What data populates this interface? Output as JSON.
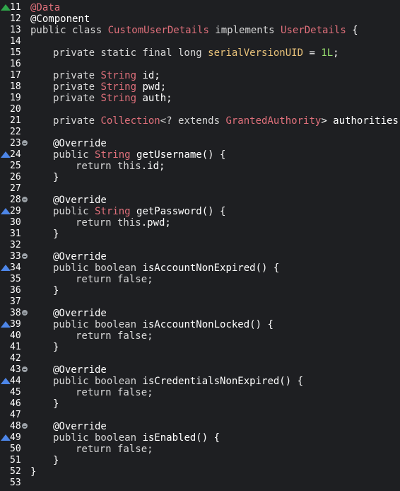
{
  "editor": {
    "colors": {
      "background": "#1e1f22",
      "keyword": "#d7d7d7",
      "type": "#e0707b",
      "field": "#e8c27a",
      "number": "#98e06f",
      "line_number": "#ffffff",
      "override_marker": "#4d86e8",
      "class_marker": "#2fa64a"
    },
    "lines": [
      {
        "num": "11",
        "marker": "green",
        "fold": false,
        "indent": 0,
        "tokens": [
          {
            "t": "@Data",
            "k": "ann-red"
          }
        ]
      },
      {
        "num": "12",
        "fold": false,
        "indent": 0,
        "tokens": [
          {
            "t": "@Component",
            "k": "ann"
          }
        ]
      },
      {
        "num": "13",
        "fold": false,
        "indent": 0,
        "tokens": [
          {
            "t": "public class ",
            "k": "kw"
          },
          {
            "t": "CustomUserDetails",
            "k": "type"
          },
          {
            "t": " implements ",
            "k": "kw"
          },
          {
            "t": "UserDetails",
            "k": "type"
          },
          {
            "t": " {",
            "k": "plain"
          }
        ]
      },
      {
        "num": "14",
        "fold": false,
        "indent": 0,
        "tokens": []
      },
      {
        "num": "15",
        "fold": false,
        "indent": 1,
        "tokens": [
          {
            "t": "private static final long ",
            "k": "kw"
          },
          {
            "t": "serialVersionUID",
            "k": "field"
          },
          {
            "t": " = ",
            "k": "plain"
          },
          {
            "t": "1L",
            "k": "num"
          },
          {
            "t": ";",
            "k": "plain"
          }
        ]
      },
      {
        "num": "16",
        "fold": false,
        "indent": 0,
        "tokens": []
      },
      {
        "num": "17",
        "fold": false,
        "indent": 1,
        "tokens": [
          {
            "t": "private ",
            "k": "kw"
          },
          {
            "t": "String",
            "k": "type"
          },
          {
            "t": " id;",
            "k": "plain"
          }
        ]
      },
      {
        "num": "18",
        "fold": false,
        "indent": 1,
        "tokens": [
          {
            "t": "private ",
            "k": "kw"
          },
          {
            "t": "String",
            "k": "type"
          },
          {
            "t": " pwd;",
            "k": "plain"
          }
        ]
      },
      {
        "num": "19",
        "fold": false,
        "indent": 1,
        "tokens": [
          {
            "t": "private ",
            "k": "kw"
          },
          {
            "t": "String",
            "k": "type"
          },
          {
            "t": " auth;",
            "k": "plain"
          }
        ]
      },
      {
        "num": "20",
        "fold": false,
        "indent": 0,
        "tokens": []
      },
      {
        "num": "21",
        "fold": false,
        "indent": 1,
        "tokens": [
          {
            "t": "private ",
            "k": "kw"
          },
          {
            "t": "Collection",
            "k": "type"
          },
          {
            "t": "<? extends ",
            "k": "kw"
          },
          {
            "t": "GrantedAuthority",
            "k": "type"
          },
          {
            "t": "> authorities;",
            "k": "plain"
          }
        ]
      },
      {
        "num": "22",
        "fold": false,
        "indent": 0,
        "tokens": []
      },
      {
        "num": "23",
        "fold": true,
        "indent": 1,
        "tokens": [
          {
            "t": "@Override",
            "k": "ann"
          }
        ]
      },
      {
        "num": "24",
        "marker": "blue",
        "fold": false,
        "indent": 1,
        "tokens": [
          {
            "t": "public ",
            "k": "kw"
          },
          {
            "t": "String",
            "k": "type"
          },
          {
            "t": " getUsername() {",
            "k": "plain"
          }
        ]
      },
      {
        "num": "25",
        "fold": false,
        "indent": 2,
        "tokens": [
          {
            "t": "return this",
            "k": "kw"
          },
          {
            "t": ".id;",
            "k": "plain"
          }
        ]
      },
      {
        "num": "26",
        "fold": false,
        "indent": 1,
        "tokens": [
          {
            "t": "}",
            "k": "plain"
          }
        ]
      },
      {
        "num": "27",
        "fold": false,
        "indent": 0,
        "tokens": []
      },
      {
        "num": "28",
        "fold": true,
        "indent": 1,
        "tokens": [
          {
            "t": "@Override",
            "k": "ann"
          }
        ]
      },
      {
        "num": "29",
        "marker": "blue",
        "fold": false,
        "indent": 1,
        "tokens": [
          {
            "t": "public ",
            "k": "kw"
          },
          {
            "t": "String",
            "k": "type"
          },
          {
            "t": " getPassword() {",
            "k": "plain"
          }
        ]
      },
      {
        "num": "30",
        "fold": false,
        "indent": 2,
        "tokens": [
          {
            "t": "return this",
            "k": "kw"
          },
          {
            "t": ".pwd;",
            "k": "plain"
          }
        ]
      },
      {
        "num": "31",
        "fold": false,
        "indent": 1,
        "tokens": [
          {
            "t": "}",
            "k": "plain"
          }
        ]
      },
      {
        "num": "32",
        "fold": false,
        "indent": 0,
        "tokens": []
      },
      {
        "num": "33",
        "fold": true,
        "indent": 1,
        "tokens": [
          {
            "t": "@Override",
            "k": "ann"
          }
        ]
      },
      {
        "num": "34",
        "marker": "blue",
        "fold": false,
        "indent": 1,
        "tokens": [
          {
            "t": "public boolean ",
            "k": "kw"
          },
          {
            "t": "isAccountNonExpired() {",
            "k": "plain"
          }
        ]
      },
      {
        "num": "35",
        "fold": false,
        "indent": 2,
        "tokens": [
          {
            "t": "return false;",
            "k": "kw"
          }
        ]
      },
      {
        "num": "36",
        "fold": false,
        "indent": 1,
        "tokens": [
          {
            "t": "}",
            "k": "plain"
          }
        ]
      },
      {
        "num": "37",
        "fold": false,
        "indent": 0,
        "tokens": []
      },
      {
        "num": "38",
        "fold": true,
        "indent": 1,
        "tokens": [
          {
            "t": "@Override",
            "k": "ann"
          }
        ]
      },
      {
        "num": "39",
        "marker": "blue",
        "fold": false,
        "indent": 1,
        "tokens": [
          {
            "t": "public boolean ",
            "k": "kw"
          },
          {
            "t": "isAccountNonLocked() {",
            "k": "plain"
          }
        ]
      },
      {
        "num": "40",
        "fold": false,
        "indent": 2,
        "tokens": [
          {
            "t": "return false;",
            "k": "kw"
          }
        ]
      },
      {
        "num": "41",
        "fold": false,
        "indent": 1,
        "tokens": [
          {
            "t": "}",
            "k": "plain"
          }
        ]
      },
      {
        "num": "42",
        "fold": false,
        "indent": 0,
        "tokens": []
      },
      {
        "num": "43",
        "fold": true,
        "indent": 1,
        "tokens": [
          {
            "t": "@Override",
            "k": "ann"
          }
        ]
      },
      {
        "num": "44",
        "marker": "blue",
        "fold": false,
        "indent": 1,
        "tokens": [
          {
            "t": "public boolean ",
            "k": "kw"
          },
          {
            "t": "isCredentialsNonExpired() {",
            "k": "plain"
          }
        ]
      },
      {
        "num": "45",
        "fold": false,
        "indent": 2,
        "tokens": [
          {
            "t": "return false;",
            "k": "kw"
          }
        ]
      },
      {
        "num": "46",
        "fold": false,
        "indent": 1,
        "tokens": [
          {
            "t": "}",
            "k": "plain"
          }
        ]
      },
      {
        "num": "47",
        "fold": false,
        "indent": 0,
        "tokens": []
      },
      {
        "num": "48",
        "fold": true,
        "indent": 1,
        "tokens": [
          {
            "t": "@Override",
            "k": "ann"
          }
        ]
      },
      {
        "num": "49",
        "marker": "blue",
        "fold": false,
        "indent": 1,
        "tokens": [
          {
            "t": "public boolean ",
            "k": "kw"
          },
          {
            "t": "isEnabled() {",
            "k": "plain"
          }
        ]
      },
      {
        "num": "50",
        "fold": false,
        "indent": 2,
        "tokens": [
          {
            "t": "return false;",
            "k": "kw"
          }
        ]
      },
      {
        "num": "51",
        "fold": false,
        "indent": 1,
        "tokens": [
          {
            "t": "}",
            "k": "plain"
          }
        ]
      },
      {
        "num": "52",
        "fold": false,
        "indent": 0,
        "tokens": [
          {
            "t": "}",
            "k": "plain"
          }
        ]
      },
      {
        "num": "53",
        "fold": false,
        "indent": 0,
        "tokens": []
      }
    ]
  }
}
